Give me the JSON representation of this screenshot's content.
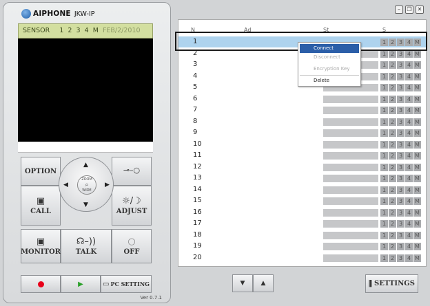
{
  "app": {
    "brand": "AIPHONE",
    "model": "JKW-IP",
    "version": "Ver 0.7.1"
  },
  "sensor": {
    "label": "SENSOR",
    "numbers": [
      "1",
      "2",
      "3",
      "4",
      "M"
    ],
    "date": "FEB/2/2010"
  },
  "controls": {
    "option": "OPTION",
    "call": "CALL",
    "adjust": "ADJUST",
    "monitor": "MONITOR",
    "talk": "TALK",
    "off": "OFF",
    "zoom": "ZOOM",
    "wide": "WIDE",
    "key_icon": "⊸–○",
    "adjust_icon": "☼/☽",
    "pc_setting": "PC SETTING"
  },
  "list": {
    "headers": [
      "N",
      "Ad",
      "St",
      "S"
    ],
    "rows": [
      "1",
      "2",
      "3",
      "4",
      "5",
      "6",
      "7",
      "8",
      "9",
      "10",
      "11",
      "12",
      "13",
      "14",
      "15",
      "16",
      "17",
      "18",
      "19",
      "20"
    ],
    "monitors": [
      "1",
      "2",
      "3",
      "4",
      "M"
    ]
  },
  "context_menu": {
    "items": [
      "Connect",
      "Disconnect",
      "Encryption Key",
      "Delete"
    ]
  },
  "settings": {
    "label": "SETTINGS"
  },
  "colors": {
    "record": "#e8001a",
    "play": "#2aa02a",
    "selected": "#aed3ee",
    "menu_active": "#2b5ea8"
  },
  "icons": {
    "record": "record-icon",
    "play": "play-icon",
    "pc": "pc-setting-icon",
    "call": "call-icon",
    "monitor": "monitor-icon",
    "talk": "talk-icon",
    "off": "off-icon",
    "adjust": "adjust-icon",
    "key": "key-icon"
  }
}
